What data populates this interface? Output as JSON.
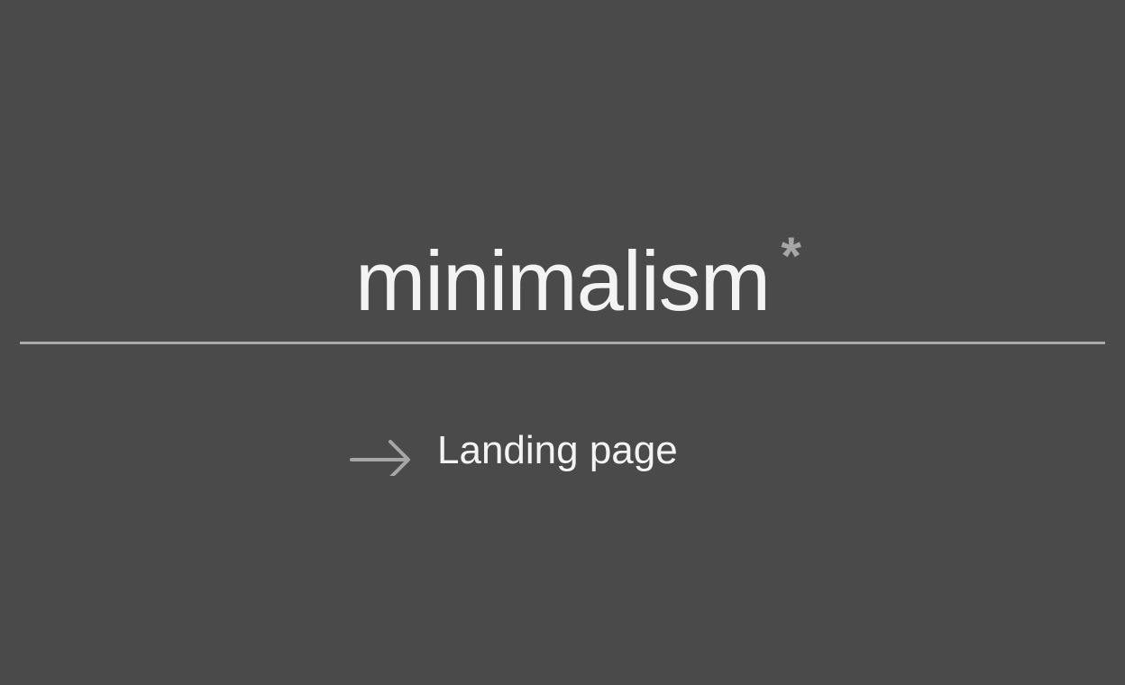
{
  "header": {
    "title": "minimalism",
    "title_mark": "*"
  },
  "nav": {
    "link_label": "Landing page",
    "link_icon": "arrow-right-icon"
  },
  "colors": {
    "background": "#4a4a4a",
    "text": "#f3f3f3",
    "accent_gray": "#a6a6a6",
    "divider": "#a9a9a9"
  }
}
